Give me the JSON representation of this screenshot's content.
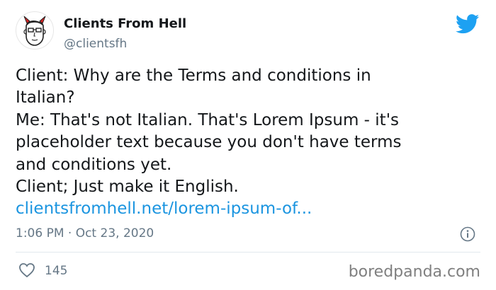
{
  "author": {
    "name": "Clients From Hell",
    "handle": "@clientsfh",
    "avatar_icon": "devil-face-avatar"
  },
  "tweet": {
    "lines": [
      "Client: Why are the Terms and conditions in",
      "Italian?",
      "Me: That's not Italian. That's Lorem Ipsum - it's",
      "placeholder text because you don't have terms",
      "and conditions yet.",
      "Client; Just make it English."
    ],
    "link": "clientsfromhell.net/lorem-ipsum-of..."
  },
  "meta": {
    "timestamp": "1:06 PM · Oct 23, 2020",
    "likes": "145"
  },
  "watermark": "boredpanda.com",
  "colors": {
    "twitter_blue": "#1da1f2",
    "link_blue": "#1b95e0",
    "muted": "#657786",
    "heart": "#657786"
  }
}
